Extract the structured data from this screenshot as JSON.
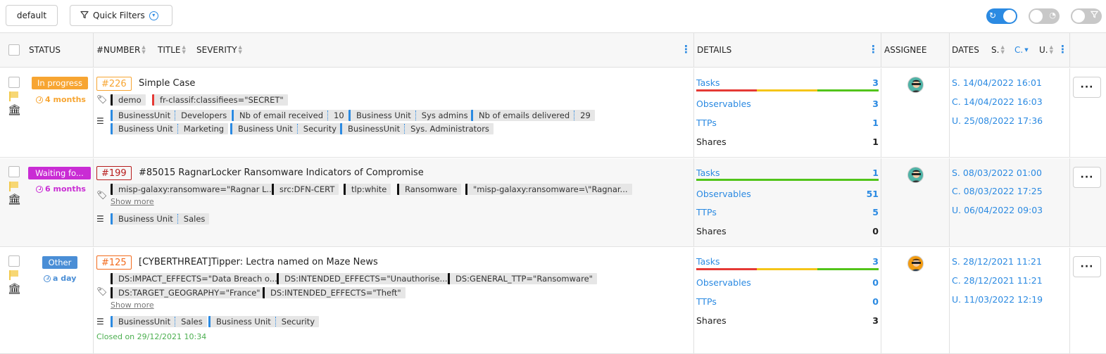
{
  "toolbar": {
    "default_label": "default",
    "quick_filters_label": "Quick Filters"
  },
  "header": {
    "status": "STATUS",
    "number": "#NUMBER",
    "title": "TITLE",
    "severity": "SEVERITY",
    "details": "DETAILS",
    "assignee": "ASSIGNEE",
    "dates": "DATES",
    "sort_s": "S.",
    "sort_c": "C.",
    "sort_u": "U."
  },
  "colors": {
    "accent": "#2b8ae2",
    "in_progress": "#f7a532",
    "waiting": "#c92cd4",
    "other": "#4a8ed6"
  },
  "rows": [
    {
      "status": "In progress",
      "age": "4 months",
      "number": "#226",
      "title": "Simple Case",
      "tags": [
        "demo",
        "fr-classif:classifiees=\"SECRET\""
      ],
      "custom_fields": [
        [
          "BusinessUnit",
          "Developers"
        ],
        [
          "Nb of email received",
          "10"
        ],
        [
          "Business Unit",
          "Sys admins"
        ],
        [
          "Nb of emails delivered",
          "29"
        ],
        [
          "Business Unit",
          "Marketing"
        ],
        [
          "Business Unit",
          "Security"
        ],
        [
          "BusinessUnit",
          "Sys. Administrators"
        ]
      ],
      "details": {
        "tasks_label": "Tasks",
        "tasks": "3",
        "observables_label": "Observables",
        "observables": "3",
        "ttps_label": "TTPs",
        "ttps": "1",
        "shares_label": "Shares",
        "shares": "1"
      },
      "dates": {
        "s": "S. 14/04/2022 16:01",
        "c": "C. 14/04/2022 16:03",
        "u": "U. 25/08/2022 17:36"
      }
    },
    {
      "status": "Waiting fo...",
      "age": "6 months",
      "number": "#199",
      "title": "#85015 RagnarLocker Ransomware Indicators of Compromise",
      "tags": [
        "misp-galaxy:ransomware=\"Ragnar L...",
        "src:DFN-CERT",
        "tlp:white",
        "Ransomware",
        "\"misp-galaxy:ransomware=\\\"Ragnar..."
      ],
      "show_more": "Show more",
      "custom_fields": [
        [
          "Business Unit",
          "Sales"
        ]
      ],
      "details": {
        "tasks_label": "Tasks",
        "tasks": "1",
        "observables_label": "Observables",
        "observables": "51",
        "ttps_label": "TTPs",
        "ttps": "5",
        "shares_label": "Shares",
        "shares": "0"
      },
      "dates": {
        "s": "S. 08/03/2022 01:00",
        "c": "C. 08/03/2022 17:25",
        "u": "U. 06/04/2022 09:03"
      }
    },
    {
      "status": "Other",
      "age": "a day",
      "number": "#125",
      "title": "[CYBERTHREAT]Tipper: Lectra named on Maze News",
      "tags": [
        "DS:IMPACT_EFFECTS=\"Data Breach o...",
        "DS:INTENDED_EFFECTS=\"Unauthorise...",
        "DS:GENERAL_TTP=\"Ransomware\"",
        "DS:TARGET_GEOGRAPHY=\"France\"",
        "DS:INTENDED_EFFECTS=\"Theft\""
      ],
      "show_more": "Show more",
      "custom_fields": [
        [
          "BusinessUnit",
          "Sales"
        ],
        [
          "Business Unit",
          "Security"
        ]
      ],
      "closed": "Closed on 29/12/2021 10:34",
      "details": {
        "tasks_label": "Tasks",
        "tasks": "3",
        "observables_label": "Observables",
        "observables": "0",
        "ttps_label": "TTPs",
        "ttps": "0",
        "shares_label": "Shares",
        "shares": "3"
      },
      "dates": {
        "s": "S. 28/12/2021 11:21",
        "c": "C. 28/12/2021 11:21",
        "u": "U. 11/03/2022 12:19"
      }
    }
  ]
}
